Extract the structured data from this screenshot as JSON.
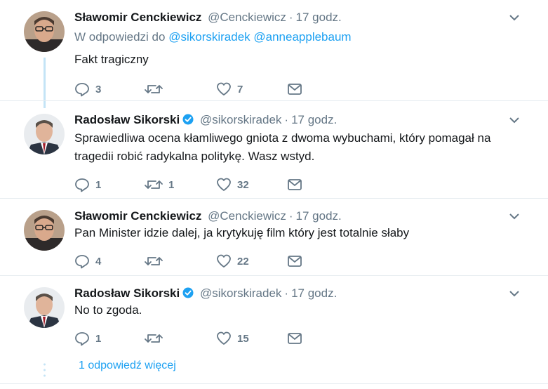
{
  "colors": {
    "accent": "#1da1f2",
    "secondary_text": "#657786",
    "thread_line": "#c4e4f6",
    "verified_badge": "#1da1f2"
  },
  "tweets": [
    {
      "name": "Sławomir Cenckiewicz",
      "handle": "@Cenckiewicz",
      "dot": "·",
      "time": "17 godz.",
      "verified": false,
      "reply_prefix": "W odpowiedzi do",
      "reply_mentions": [
        "@sikorskiradek",
        "@anneapplebaum"
      ],
      "text": "Fakt tragiczny",
      "replies": "3",
      "retweets": "",
      "likes": "7"
    },
    {
      "name": "Radosław Sikorski",
      "handle": "@sikorskiradek",
      "dot": "·",
      "time": "17 godz.",
      "verified": true,
      "text": "Sprawiedliwa ocena kłamliwego gniota z dwoma wybuchami, który pomagał na tragedii robić radykalna politykę.  Wasz wstyd.",
      "replies": "1",
      "retweets": "1",
      "likes": "32"
    },
    {
      "name": "Sławomir Cenckiewicz",
      "handle": "@Cenckiewicz",
      "dot": "·",
      "time": "17 godz.",
      "verified": false,
      "text": "Pan Minister idzie dalej, ja krytykuję film który jest totalnie słaby",
      "replies": "4",
      "retweets": "",
      "likes": "22"
    },
    {
      "name": "Radosław Sikorski",
      "handle": "@sikorskiradek",
      "dot": "·",
      "time": "17 godz.",
      "verified": true,
      "text": "No to zgoda.",
      "replies": "1",
      "retweets": "",
      "likes": "15"
    }
  ],
  "more_replies": "1 odpowiedź więcej"
}
